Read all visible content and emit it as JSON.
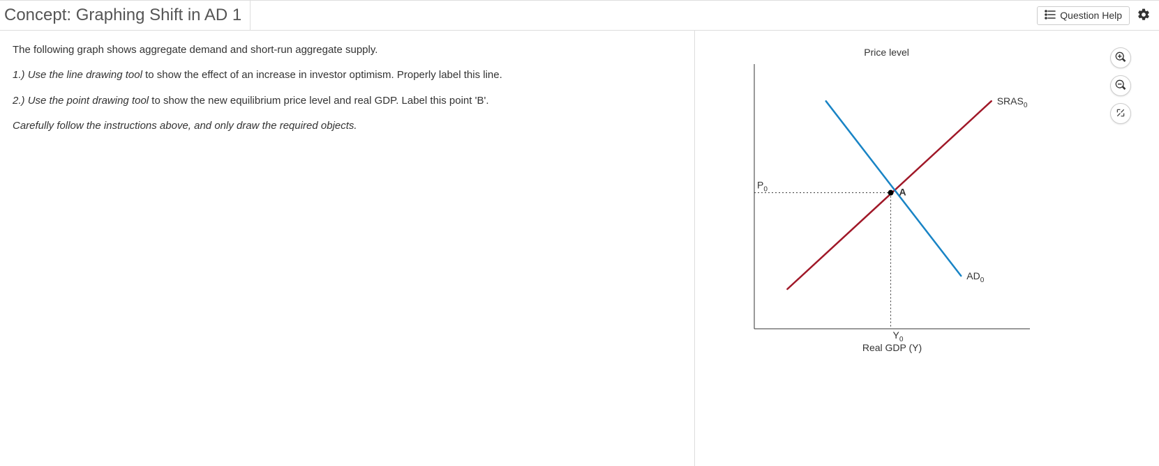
{
  "header": {
    "title": "Concept: Graphing Shift in AD 1",
    "help_label": "Question Help"
  },
  "instructions": {
    "intro": "The following graph shows aggregate demand and short-run aggregate supply.",
    "step1_prefix": "1.) ",
    "step1_italic": "Use the line drawing tool",
    "step1_rest": " to show the effect of an increase in investor optimism. Properly label this line.",
    "step2_prefix": "2.) ",
    "step2_italic": "Use the point drawing tool",
    "step2_rest": " to show the new equilibrium price level and real GDP. Label this point 'B'.",
    "caution": "Carefully follow the instructions above, and only draw the required objects."
  },
  "chart_data": {
    "type": "line",
    "title": "",
    "ylabel": "Price level",
    "xlabel": "Real GDP (Y)",
    "xlim": [
      0,
      10
    ],
    "ylim": [
      0,
      10
    ],
    "series": [
      {
        "name": "SRAS0",
        "color": "#a01828",
        "x": [
          1.2,
          8.6
        ],
        "y": [
          1.5,
          8.6
        ],
        "label_pos": "end"
      },
      {
        "name": "AD0",
        "color": "#1984c5",
        "x": [
          2.6,
          7.5
        ],
        "y": [
          8.6,
          2.0
        ],
        "label_pos": "end"
      }
    ],
    "points": [
      {
        "name": "A",
        "x": 4.95,
        "y": 5.14,
        "label_offset": [
          12,
          4
        ]
      }
    ],
    "guides": [
      {
        "axis": "y",
        "value": 5.14,
        "label": "P0"
      },
      {
        "axis": "x",
        "value": 4.95,
        "label": "Y0"
      }
    ]
  }
}
